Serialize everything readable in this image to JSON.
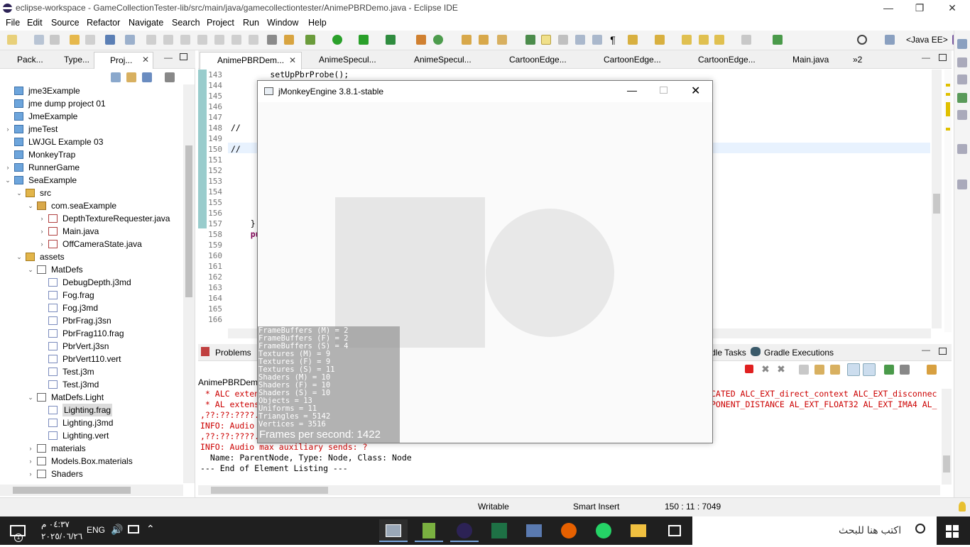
{
  "window": {
    "title": "eclipse-workspace - GameCollectionTester-lib/src/main/java/gamecollectiontester/AnimePBRDemo.java - Eclipse IDE",
    "minimize": "—",
    "restore": "❐",
    "close": "✕"
  },
  "menu": [
    "File",
    "Edit",
    "Source",
    "Refactor",
    "Navigate",
    "Search",
    "Project",
    "Run",
    "Window",
    "Help"
  ],
  "toolbar": {
    "perspective": "<Java EE>"
  },
  "left_panel": {
    "tabs": [
      {
        "label": "Pack..."
      },
      {
        "label": "Type..."
      },
      {
        "label": "Proj...",
        "active": true
      }
    ],
    "tree": [
      {
        "label": "jme3Example",
        "depth": 0,
        "icon": "project-icon",
        "arrow": ""
      },
      {
        "label": "jme dump project 01",
        "depth": 0,
        "icon": "project-icon",
        "arrow": ""
      },
      {
        "label": "JmeExample",
        "depth": 0,
        "icon": "project-icon",
        "arrow": ""
      },
      {
        "label": "jmeTest",
        "depth": 0,
        "icon": "project-icon",
        "arrow": "›"
      },
      {
        "label": "LWJGL Example 03",
        "depth": 0,
        "icon": "project-icon",
        "arrow": ""
      },
      {
        "label": "MonkeyTrap",
        "depth": 0,
        "icon": "project-icon",
        "arrow": ""
      },
      {
        "label": "RunnerGame",
        "depth": 0,
        "icon": "project-icon",
        "arrow": "›"
      },
      {
        "label": "SeaExample",
        "depth": 0,
        "icon": "project-icon",
        "arrow": "⌄"
      },
      {
        "label": "src",
        "depth": 1,
        "icon": "source-folder-icon",
        "arrow": "⌄"
      },
      {
        "label": "com.seaExample",
        "depth": 2,
        "icon": "package-icon",
        "arrow": "⌄"
      },
      {
        "label": "DepthTextureRequester.java",
        "depth": 3,
        "icon": "java-file-icon",
        "arrow": "›"
      },
      {
        "label": "Main.java",
        "depth": 3,
        "icon": "java-file-icon",
        "arrow": "›"
      },
      {
        "label": "OffCameraState.java",
        "depth": 3,
        "icon": "java-file-icon",
        "arrow": "›"
      },
      {
        "label": "assets",
        "depth": 1,
        "icon": "source-folder-icon",
        "arrow": "⌄"
      },
      {
        "label": "MatDefs",
        "depth": 2,
        "icon": "folder-icon",
        "arrow": "⌄"
      },
      {
        "label": "DebugDepth.j3md",
        "depth": 3,
        "icon": "file-icon",
        "arrow": ""
      },
      {
        "label": "Fog.frag",
        "depth": 3,
        "icon": "file-icon",
        "arrow": ""
      },
      {
        "label": "Fog.j3md",
        "depth": 3,
        "icon": "file-icon",
        "arrow": ""
      },
      {
        "label": "PbrFrag.j3sn",
        "depth": 3,
        "icon": "file-icon",
        "arrow": ""
      },
      {
        "label": "PbrFrag110.frag",
        "depth": 3,
        "icon": "file-icon",
        "arrow": ""
      },
      {
        "label": "PbrVert.j3sn",
        "depth": 3,
        "icon": "file-icon",
        "arrow": ""
      },
      {
        "label": "PbrVert110.vert",
        "depth": 3,
        "icon": "file-icon",
        "arrow": ""
      },
      {
        "label": "Test.j3m",
        "depth": 3,
        "icon": "file-icon",
        "arrow": ""
      },
      {
        "label": "Test.j3md",
        "depth": 3,
        "icon": "file-icon",
        "arrow": ""
      },
      {
        "label": "MatDefs.Light",
        "depth": 2,
        "icon": "folder-icon",
        "arrow": "⌄"
      },
      {
        "label": "Lighting.frag",
        "depth": 3,
        "icon": "file-icon",
        "arrow": "",
        "selected": true
      },
      {
        "label": "Lighting.j3md",
        "depth": 3,
        "icon": "file-icon",
        "arrow": ""
      },
      {
        "label": "Lighting.vert",
        "depth": 3,
        "icon": "file-icon",
        "arrow": ""
      },
      {
        "label": "materials",
        "depth": 2,
        "icon": "folder-icon",
        "arrow": "›"
      },
      {
        "label": "Models.Box.materials",
        "depth": 2,
        "icon": "folder-icon",
        "arrow": "›"
      },
      {
        "label": "Shaders",
        "depth": 2,
        "icon": "folder-icon",
        "arrow": "›"
      }
    ]
  },
  "editor": {
    "tabs": [
      {
        "label": "AnimePBRDem...",
        "active": true
      },
      {
        "label": "AnimeSpecul..."
      },
      {
        "label": "AnimeSpecul..."
      },
      {
        "label": "CartoonEdge..."
      },
      {
        "label": "CartoonEdge..."
      },
      {
        "label": "CartoonEdge..."
      },
      {
        "label": "Main.java"
      },
      {
        "label": "»2"
      }
    ],
    "lines": [
      {
        "n": "143",
        "code": "        setUpPbrProbe();"
      },
      {
        "n": "144",
        "code": ""
      },
      {
        "n": "145",
        "code": ""
      },
      {
        "n": "146",
        "code": ""
      },
      {
        "n": "147",
        "code": ""
      },
      {
        "n": "148",
        "code": "//"
      },
      {
        "n": "149",
        "code": ""
      },
      {
        "n": "150",
        "code": "//"
      },
      {
        "n": "151",
        "code": ""
      },
      {
        "n": "152",
        "code": ""
      },
      {
        "n": "153",
        "code": ""
      },
      {
        "n": "154",
        "code": ""
      },
      {
        "n": "155",
        "code": ""
      },
      {
        "n": "156",
        "code": ""
      },
      {
        "n": "157",
        "code": "    }"
      },
      {
        "n": "158",
        "code": "    pu"
      },
      {
        "n": "159",
        "code": ""
      },
      {
        "n": "160",
        "code": ""
      },
      {
        "n": "161",
        "code": ""
      },
      {
        "n": "162",
        "code": ""
      },
      {
        "n": "163",
        "code": ""
      },
      {
        "n": "164",
        "code": ""
      },
      {
        "n": "165",
        "code": ""
      },
      {
        "n": "166",
        "code": ""
      }
    ]
  },
  "console": {
    "tab_problems": "Problems",
    "tab_tasks": "dle Tasks",
    "tab_gradle": "Gradle Executions",
    "header": "AnimePBRDem",
    "lines": [
      {
        "text": " * ALC exten",
        "color": "#cc0000"
      },
      {
        "text": " * AL extens",
        "color": "#cc0000"
      },
      {
        "text": ",??:??:????.??,",
        "color": "#cc0000"
      },
      {
        "text": "INFO: Audio",
        "color": "#cc0000"
      },
      {
        "text": ",??:??:????.??,",
        "color": "#cc0000"
      },
      {
        "text": "INFO: Audio max auxiliary sends: ?",
        "color": "#cc0000"
      },
      {
        "text": "  Name: ParentNode, Type: Node, Class: Node",
        "color": "#000000"
      },
      {
        "text": "--- End of Element Listing ---",
        "color": "#000000"
      }
    ],
    "right_lines": [
      "CATED ALC_EXT_direct_context ALC_EXT_disconnec",
      "PONENT_DISTANCE AL_EXT_FLOAT32 AL_EXT_IMA4 AL_"
    ]
  },
  "status": {
    "writable": "Writable",
    "insert_mode": "Smart Insert",
    "position": "150 : 11 : 7049"
  },
  "jme_window": {
    "title": "jMonkeyEngine 3.8.1-stable",
    "stats": [
      "FrameBuffers (M) = 2",
      "FrameBuffers (F) = 2",
      "FrameBuffers (S) = 4",
      "Textures (M) = 9",
      "Textures (F) = 9",
      "Textures (S) = 11",
      "Shaders (M) = 10",
      "Shaders (F) = 10",
      "Shaders (S) = 10",
      "Objects = 13",
      "Uniforms = 11",
      "Triangles = 5142",
      "Vertices = 3516"
    ],
    "fps": "Frames per second: 1422"
  },
  "taskbar": {
    "search_placeholder": "اكتب هنا للبحث",
    "language": "ENG",
    "time": "٠٤:٣٧ م",
    "date": "٢٠٢٥/٠٦/٢٦"
  }
}
